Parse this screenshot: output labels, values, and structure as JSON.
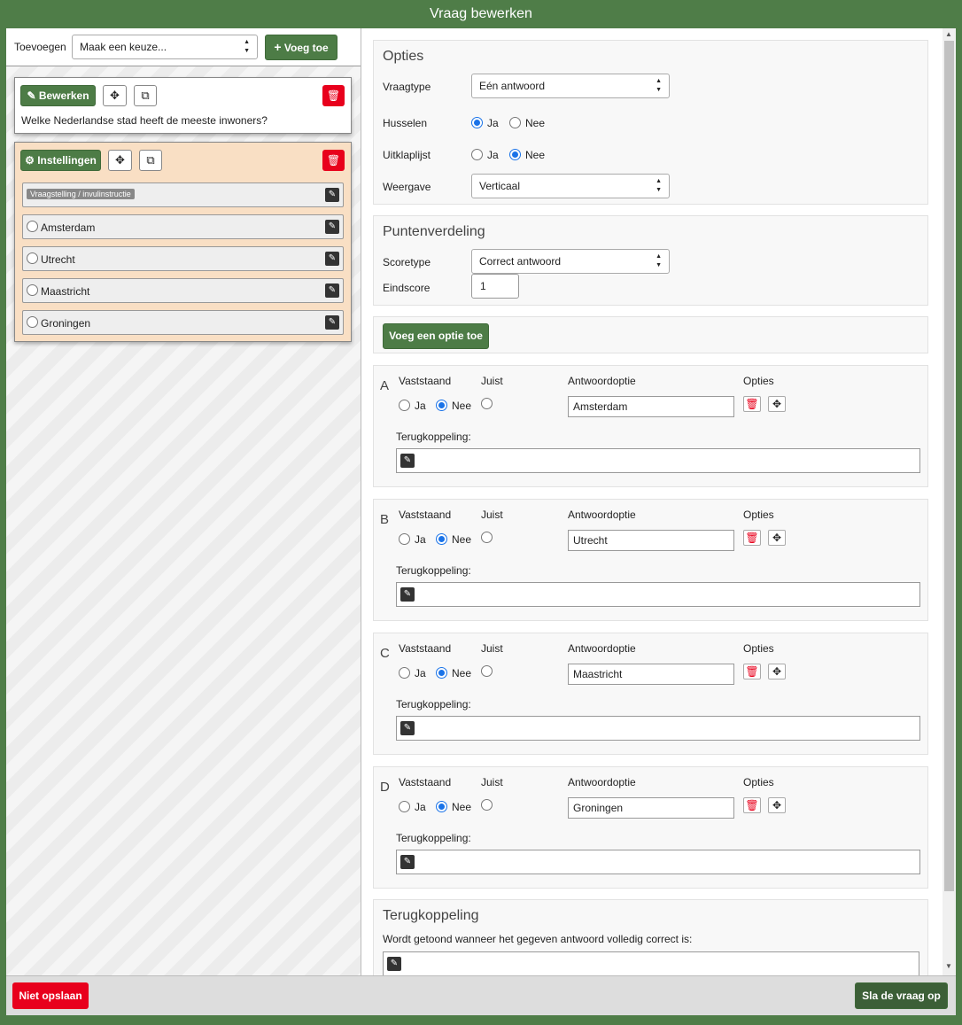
{
  "window": {
    "title": "Vraag bewerken"
  },
  "toolbar": {
    "add_label": "Toevoegen",
    "select_value": "Maak een keuze...",
    "add_button": "Voeg toe"
  },
  "question_card": {
    "edit_button": "Bewerken",
    "question_text": "Welke Nederlandse stad heeft de meeste inwoners?"
  },
  "settings_card": {
    "settings_button": "Instellingen",
    "instruction_badge": "Vraagstelling / invulinstructie",
    "options": [
      {
        "label": "Amsterdam"
      },
      {
        "label": "Utrecht"
      },
      {
        "label": "Maastricht"
      },
      {
        "label": "Groningen"
      }
    ]
  },
  "opties": {
    "heading": "Opties",
    "vraagtype_label": "Vraagtype",
    "vraagtype_value": "Eén antwoord",
    "husselen_label": "Husselen",
    "uitklaplijst_label": "Uitklaplijst",
    "ja": "Ja",
    "nee": "Nee",
    "husselen_selected": "Ja",
    "uitklaplijst_selected": "Nee",
    "weergave_label": "Weergave",
    "weergave_value": "Verticaal"
  },
  "punten": {
    "heading": "Puntenverdeling",
    "scoretype_label": "Scoretype",
    "scoretype_value": "Correct antwoord",
    "eindscore_label": "Eindscore",
    "eindscore_value": "1"
  },
  "add_option_button": "Voeg een optie toe",
  "answer_headers": {
    "vaststaand": "Vaststaand",
    "juist": "Juist",
    "antwoordoptie": "Antwoordoptie",
    "opties": "Opties",
    "terugkoppeling": "Terugkoppeling:"
  },
  "answers": [
    {
      "letter": "A",
      "value": "Amsterdam",
      "vaststaand": "Nee"
    },
    {
      "letter": "B",
      "value": "Utrecht",
      "vaststaand": "Nee"
    },
    {
      "letter": "C",
      "value": "Maastricht",
      "vaststaand": "Nee"
    },
    {
      "letter": "D",
      "value": "Groningen",
      "vaststaand": "Nee"
    }
  ],
  "terugkoppeling": {
    "heading": "Terugkoppeling",
    "description": "Wordt getoond wanneer het gegeven antwoord volledig correct is:"
  },
  "footer": {
    "cancel_button": "Niet opslaan",
    "save_button": "Sla de vraag op"
  },
  "colors": {
    "green": "#4d7c46",
    "red": "#e8001c",
    "radio_blue": "#1a73e8",
    "settings_bg": "#f9dfc4"
  }
}
